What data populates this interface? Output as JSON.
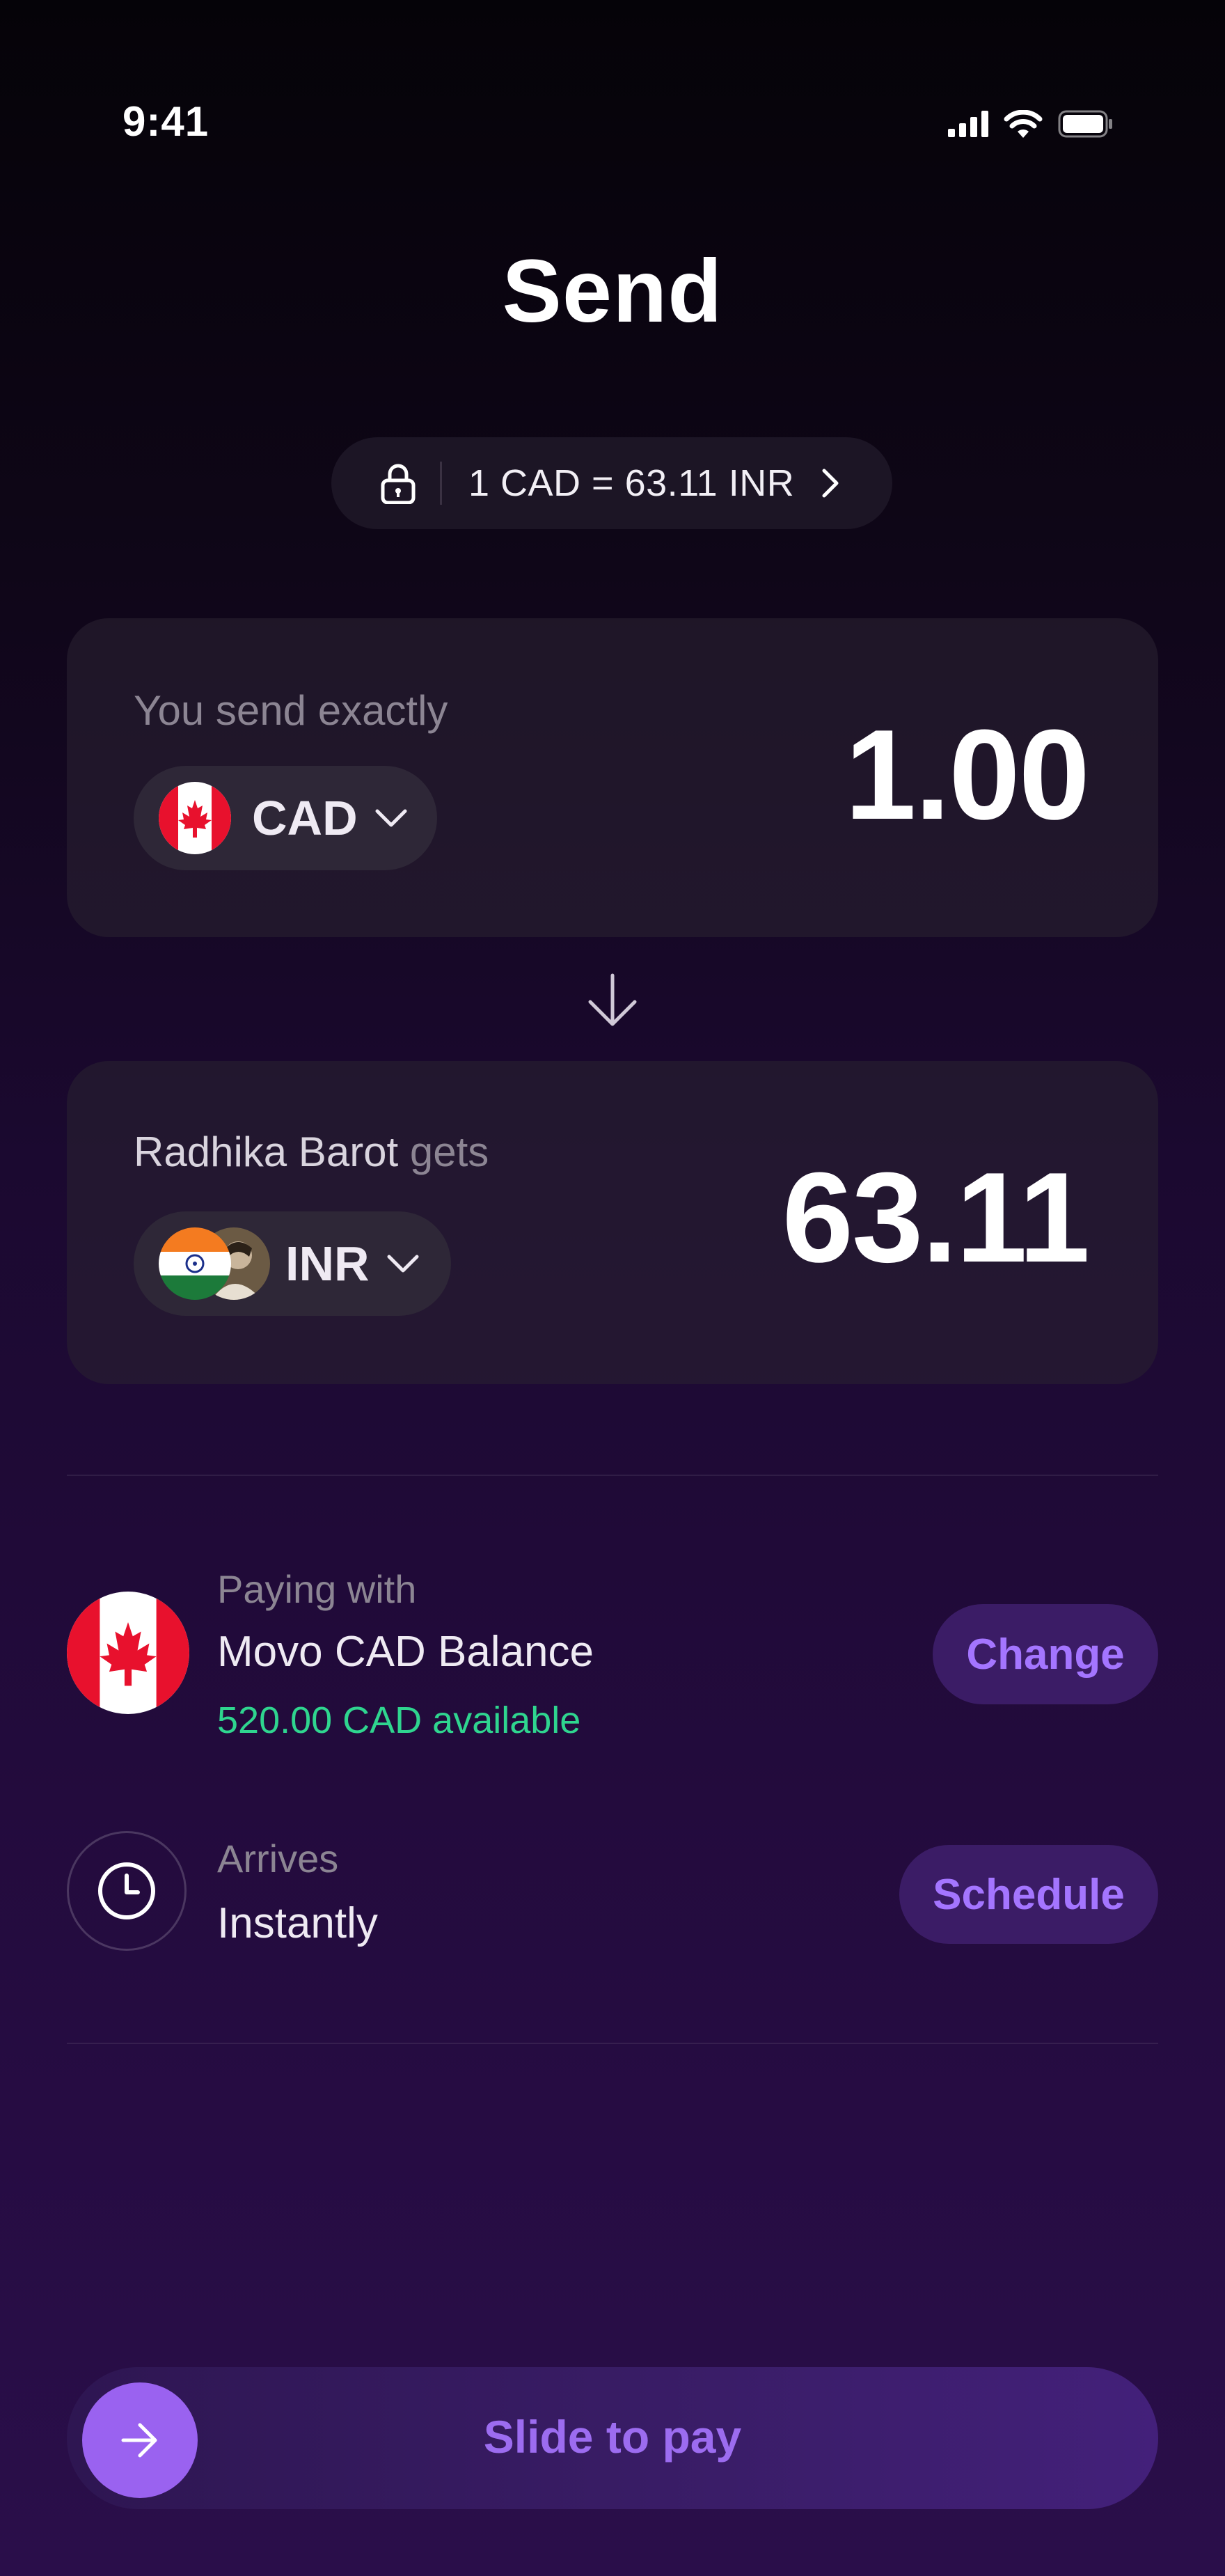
{
  "status": {
    "time": "9:41"
  },
  "title": "Send",
  "rate": {
    "text": "1 CAD = 63.11 INR"
  },
  "send": {
    "label": "You send exactly",
    "currency": "CAD",
    "amount": "1.00"
  },
  "receive": {
    "recipient": "Radhika Barot",
    "label_suffix": " gets",
    "currency": "INR",
    "amount": "63.11"
  },
  "payment": {
    "label": "Paying with",
    "method": "Movo CAD Balance",
    "available": "520.00 CAD available",
    "change_label": "Change"
  },
  "arrival": {
    "label": "Arrives",
    "value": "Instantly",
    "schedule_label": "Schedule"
  },
  "slide": {
    "label": "Slide to pay"
  },
  "colors": {
    "accent": "#9a62f0",
    "available_green": "#2fd58f",
    "button_bg": "#3b1c66"
  }
}
